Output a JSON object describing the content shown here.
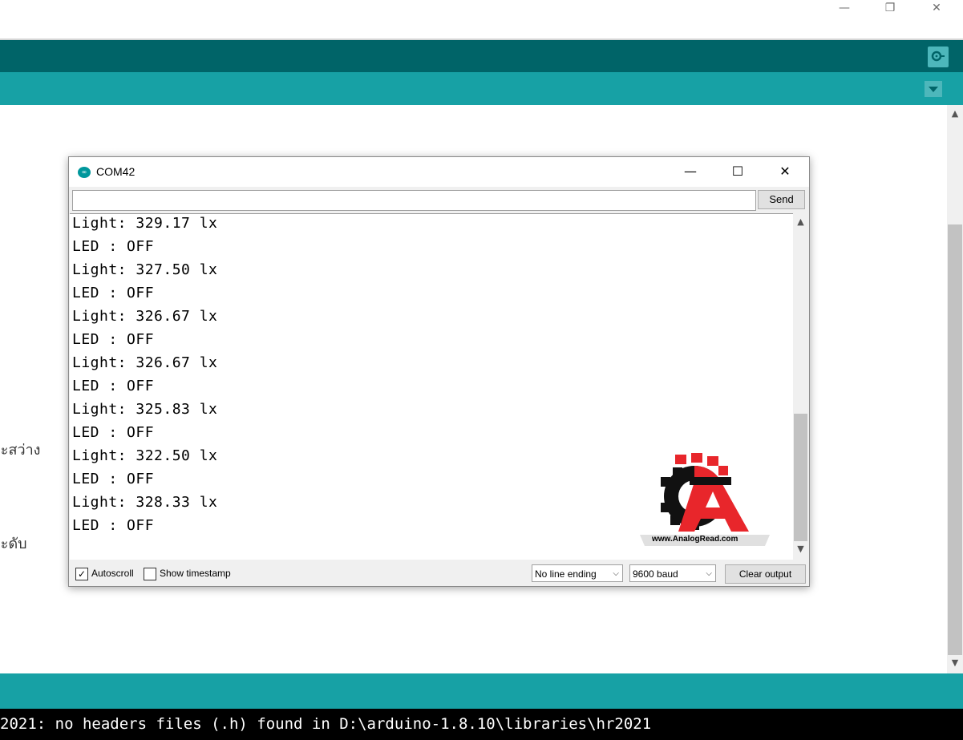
{
  "ide": {
    "console_line": "2021: no headers files (.h) found in D:\\arduino-1.8.10\\libraries\\hr2021",
    "editor_fragments": [
      "อะสว่าง",
      "อะดับ"
    ]
  },
  "serial_monitor": {
    "title": "COM42",
    "send_input_value": "",
    "send_label": "Send",
    "output_lines": [
      "Light: 329.17 lx",
      "LED : OFF",
      "Light: 327.50 lx",
      "LED : OFF",
      "Light: 326.67 lx",
      "LED : OFF",
      "Light: 326.67 lx",
      "LED : OFF",
      "Light: 325.83 lx",
      "LED : OFF",
      "Light: 322.50 lx",
      "LED : OFF",
      "Light: 328.33 lx",
      "LED : OFF"
    ],
    "autoscroll_label": "Autoscroll",
    "autoscroll_checked": true,
    "timestamp_label": "Show timestamp",
    "timestamp_checked": false,
    "line_ending_value": "No line ending",
    "baud_value": "9600 baud",
    "clear_label": "Clear output"
  },
  "watermark": {
    "text": "www.AnalogRead.com"
  },
  "colors": {
    "toolbar": "#006468",
    "tabbar": "#17a1a5",
    "console_bg": "#000000",
    "logo_red": "#e8262b"
  },
  "icons": {
    "serial_monitor": "magnifier-icon",
    "tab_menu": "triangle-down-icon",
    "minimize": "minimize-icon",
    "restore": "restore-icon",
    "close": "close-icon"
  }
}
